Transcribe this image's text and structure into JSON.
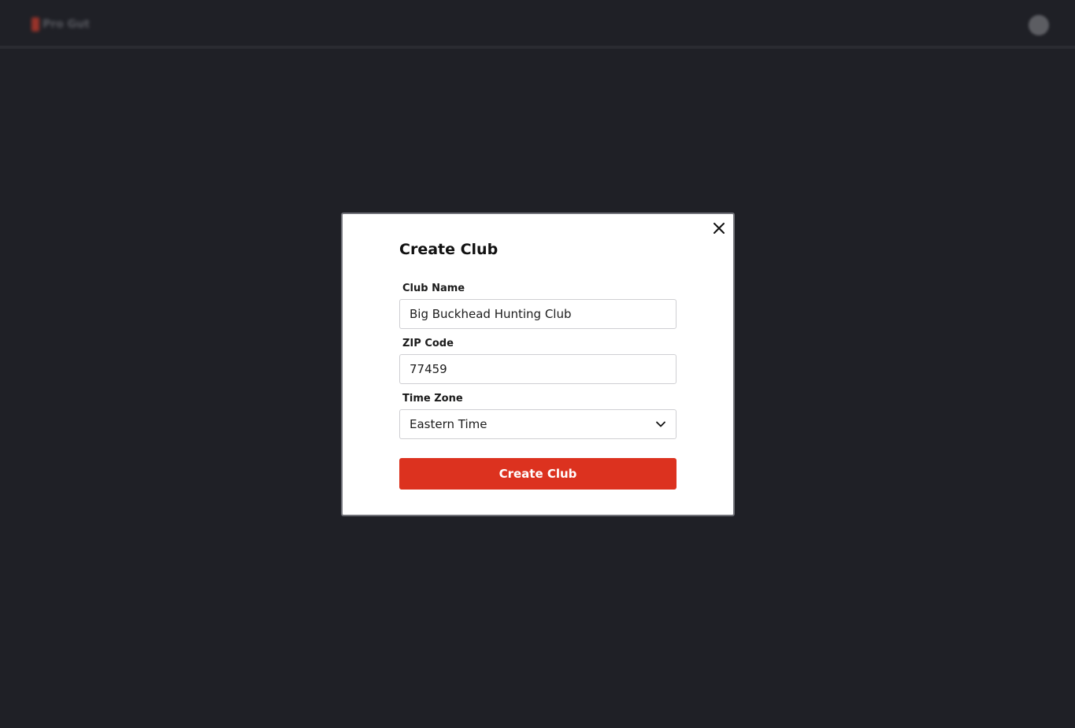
{
  "header": {
    "brand_name": "Pro Gut",
    "brand_color": "#c0392b",
    "user_icon": "user-avatar"
  },
  "modal": {
    "title": "Create Club",
    "close_icon": "close-icon",
    "fields": {
      "club_name": {
        "label": "Club Name",
        "value": "Big Buckhead Hunting Club"
      },
      "zip_code": {
        "label": "ZIP Code",
        "value": "77459"
      },
      "time_zone": {
        "label": "Time Zone",
        "value": "Eastern Time",
        "icon": "chevron-down-icon"
      }
    },
    "submit_label": "Create Club",
    "submit_color": "#dc321f"
  },
  "theme": {
    "background": "#1f2026",
    "modal_background": "#ffffff"
  }
}
